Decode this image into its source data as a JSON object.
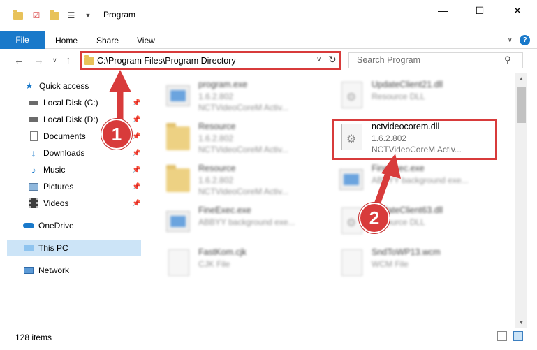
{
  "window": {
    "title": "Program",
    "minimize": "—",
    "maximize": "☐",
    "close": "✕"
  },
  "ribbon": {
    "file": "File",
    "tabs": [
      "Home",
      "Share",
      "View"
    ],
    "expand": "∨",
    "help": "?"
  },
  "nav": {
    "back": "←",
    "forward": "→",
    "recent": "∨",
    "up": "↑",
    "address": "C:\\Program Files\\Program Directory",
    "address_dropdown": "∨",
    "refresh": "↻",
    "search_placeholder": "Search Program"
  },
  "sidebar": {
    "quick_access": "Quick access",
    "pinned": [
      {
        "label": "Local Disk (C:)",
        "icon": "drive-icon"
      },
      {
        "label": "Local Disk (D:)",
        "icon": "drive-icon"
      },
      {
        "label": "Documents",
        "icon": "documents-icon"
      },
      {
        "label": "Downloads",
        "icon": "downloads-icon"
      },
      {
        "label": "Music",
        "icon": "music-icon"
      },
      {
        "label": "Pictures",
        "icon": "pictures-icon"
      },
      {
        "label": "Videos",
        "icon": "videos-icon"
      }
    ],
    "onedrive": "OneDrive",
    "thispc": "This PC",
    "network": "Network"
  },
  "files": [
    {
      "name": "program.exe",
      "line2": "1.6.2.802",
      "line3": "NCTVideoCoreM Activ...",
      "icon": "exe",
      "blurred": true
    },
    {
      "name": "UpdateClient21.dll",
      "line2": "Resource DLL",
      "line3": "",
      "icon": "dll",
      "blurred": true
    },
    {
      "name": "Resource",
      "line2": "1.6.2.802",
      "line3": "NCTVideoCoreM Activ...",
      "icon": "folder",
      "blurred": true
    },
    {
      "name": "nctvideocorem.dll",
      "line2": "1.6.2.802",
      "line3": "NCTVideoCoreM Activ...",
      "icon": "dll",
      "blurred": false
    },
    {
      "name": "Resource",
      "line2": "1.6.2.802",
      "line3": "NCTVideoCoreM Activ...",
      "icon": "folder",
      "blurred": true
    },
    {
      "name": "FineExec.exe",
      "line2": "ABBYY background exe...",
      "line3": "",
      "icon": "exe",
      "blurred": true
    },
    {
      "name": "FineExec.exe",
      "line2": "ABBYY background exe...",
      "line3": "",
      "icon": "exe",
      "blurred": true
    },
    {
      "name": "UpdateClient63.dll",
      "line2": "Resource DLL",
      "line3": "",
      "icon": "dll",
      "blurred": true
    },
    {
      "name": "FastKom.cjk",
      "line2": "CJK File",
      "line3": "",
      "icon": "doc",
      "blurred": true
    },
    {
      "name": "SndToWP13.wcm",
      "line2": "WCM File",
      "line3": "",
      "icon": "doc",
      "blurred": true
    }
  ],
  "status": {
    "item_count": "128 items"
  },
  "callouts": [
    "1",
    "2"
  ],
  "colors": {
    "accent": "#1979ca",
    "highlight": "#d83b3b",
    "selected": "#cce4f7"
  }
}
